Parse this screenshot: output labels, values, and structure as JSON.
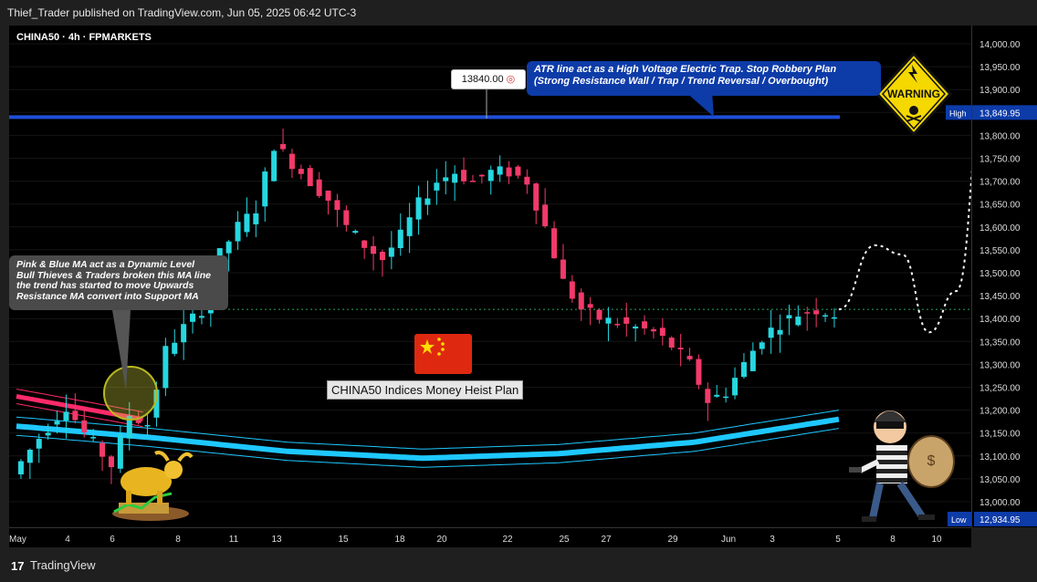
{
  "header": {
    "publish_line": "Thief_Trader published on TradingView.com, Jun 05, 2025 06:42 UTC-3"
  },
  "chart": {
    "symbol_line": "CHINA50 · 4h · FPMARKETS"
  },
  "annotations": {
    "atr_callout_line1": "ATR line act as a High Voltage Electric Trap. Stop Robbery Plan",
    "atr_callout_line2": "(Strong Resistance Wall / Trap / Trend Reversal / Overbought)",
    "ma_callout_line1": "Pink & Blue MA act as a Dynamic Level",
    "ma_callout_line2": "Bull Thieves & Traders broken this MA line",
    "ma_callout_line3": "the trend has started to move Upwards",
    "ma_callout_line4": "Resistance MA convert into Support MA",
    "price_tag": "13840.00",
    "plan_label": "CHINA50 Indices Money Heist Plan",
    "warning_label": "WARNING"
  },
  "footer": {
    "logo": "17",
    "brand": "TradingView"
  },
  "colors": {
    "up": "#26d7e0",
    "down": "#f23a6a",
    "resistance": "#1e4fd8",
    "ma_blue": "#1ec8ff",
    "ma_pink": "#ff2a6a",
    "callout_blue": "#0d3ba8"
  },
  "chart_data": {
    "type": "candlestick",
    "y_axis": {
      "min": 12934.95,
      "max": 14000,
      "ticks": [
        "14,000.00",
        "13,950.00",
        "13,900.00",
        "13,850.00",
        "13,800.00",
        "13,750.00",
        "13,700.00",
        "13,650.00",
        "13,600.00",
        "13,550.00",
        "13,500.00",
        "13,450.00",
        "13,400.00",
        "13,350.00",
        "13,300.00",
        "13,250.00",
        "13,200.00",
        "13,150.00",
        "13,100.00",
        "13,050.00",
        "13,000.00"
      ],
      "tick_values": [
        14000,
        13950,
        13900,
        13850,
        13800,
        13750,
        13700,
        13650,
        13600,
        13550,
        13500,
        13450,
        13400,
        13350,
        13300,
        13250,
        13200,
        13150,
        13100,
        13050,
        13000
      ],
      "high_label": "High",
      "high_value": "13,849.95",
      "low_label": "Low",
      "low_value": "12,934.95"
    },
    "x_axis": {
      "ticks": [
        "May",
        "4",
        "6",
        "8",
        "11",
        "13",
        "15",
        "18",
        "20",
        "22",
        "25",
        "27",
        "29",
        "Jun",
        "3",
        "5",
        "8",
        "10"
      ]
    },
    "resistance_level": 13840,
    "current_price_level": 13420,
    "price_path": [
      [
        0,
        13060
      ],
      [
        3,
        13140
      ],
      [
        6,
        13210
      ],
      [
        8,
        13150
      ],
      [
        11,
        13080
      ],
      [
        13,
        13190
      ],
      [
        15,
        13170
      ],
      [
        17,
        13330
      ],
      [
        19,
        13380
      ],
      [
        21,
        13420
      ],
      [
        23,
        13540
      ],
      [
        25,
        13600
      ],
      [
        27,
        13640
      ],
      [
        29,
        13780
      ],
      [
        31,
        13740
      ],
      [
        33,
        13700
      ],
      [
        35,
        13660
      ],
      [
        37,
        13600
      ],
      [
        39,
        13560
      ],
      [
        41,
        13530
      ],
      [
        43,
        13580
      ],
      [
        45,
        13650
      ],
      [
        47,
        13700
      ],
      [
        49,
        13720
      ],
      [
        51,
        13700
      ],
      [
        53,
        13720
      ],
      [
        55,
        13720
      ],
      [
        57,
        13700
      ],
      [
        59,
        13600
      ],
      [
        61,
        13480
      ],
      [
        63,
        13420
      ],
      [
        65,
        13400
      ],
      [
        67,
        13390
      ],
      [
        69,
        13380
      ],
      [
        71,
        13370
      ],
      [
        73,
        13340
      ],
      [
        75,
        13300
      ],
      [
        77,
        13220
      ],
      [
        79,
        13240
      ],
      [
        81,
        13300
      ],
      [
        83,
        13360
      ],
      [
        85,
        13390
      ],
      [
        87,
        13410
      ],
      [
        89,
        13420
      ],
      [
        91,
        13410
      ]
    ],
    "ma_curve": [
      [
        0,
        13165
      ],
      [
        15,
        13140
      ],
      [
        30,
        13110
      ],
      [
        45,
        13095
      ],
      [
        60,
        13105
      ],
      [
        75,
        13130
      ],
      [
        91,
        13180
      ]
    ],
    "pink_ma": [
      [
        0,
        13230
      ],
      [
        14,
        13180
      ]
    ],
    "projection_path": [
      [
        91,
        13420
      ],
      [
        95,
        13560
      ],
      [
        98,
        13540
      ],
      [
        101,
        13370
      ],
      [
        104,
        13460
      ],
      [
        107,
        13860
      ]
    ]
  }
}
